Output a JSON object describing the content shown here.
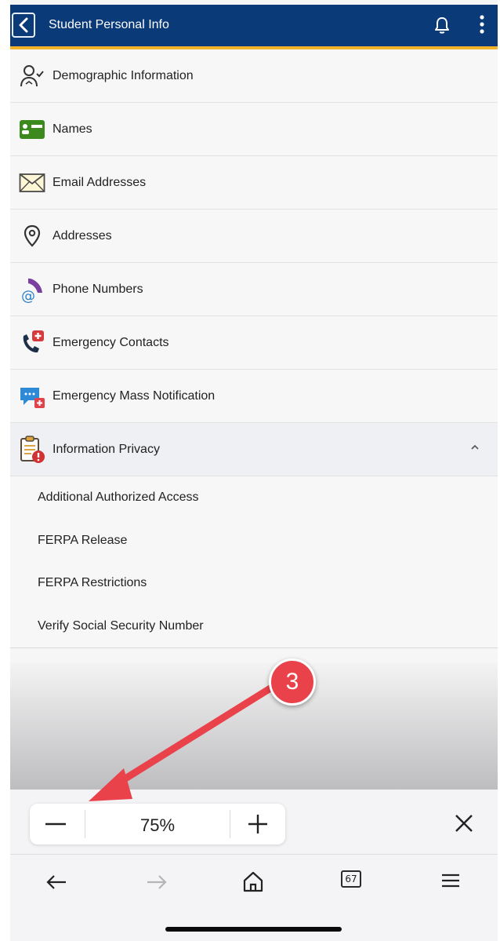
{
  "header": {
    "title": "Student Personal Info",
    "back_icon": "chevron-left-icon",
    "notification_icon": "bell-icon",
    "more_icon": "kebab-menu-icon"
  },
  "menu": {
    "items": [
      {
        "label": "Demographic Information",
        "icon": "person-check-icon"
      },
      {
        "label": "Names",
        "icon": "id-card-icon"
      },
      {
        "label": "Email Addresses",
        "icon": "envelope-icon"
      },
      {
        "label": "Addresses",
        "icon": "location-pin-icon"
      },
      {
        "label": "Phone Numbers",
        "icon": "phone-at-icon"
      },
      {
        "label": "Emergency Contacts",
        "icon": "phone-medical-icon"
      },
      {
        "label": "Emergency Mass Notification",
        "icon": "chat-alert-icon"
      },
      {
        "label": "Information Privacy",
        "icon": "clipboard-alert-icon",
        "expanded": true
      }
    ],
    "submenu": [
      "Additional Authorized Access",
      "FERPA Release",
      "FERPA Restrictions",
      "Verify Social Security Number"
    ]
  },
  "zoom": {
    "value": "75%"
  },
  "browser_nav": {
    "tab_count": "67"
  },
  "annotation": {
    "step": "3"
  },
  "colors": {
    "header_bg": "#0a3a78",
    "header_accent": "#f0b32a",
    "annotation_red": "#e9424a"
  }
}
